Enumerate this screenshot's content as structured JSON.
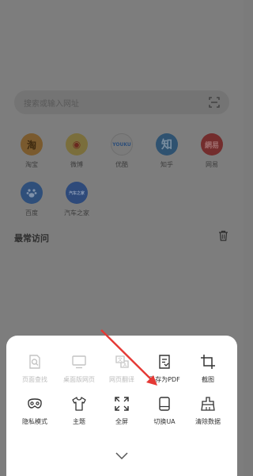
{
  "search": {
    "placeholder": "搜索或输入网址"
  },
  "quick_links": [
    {
      "label": "淘宝",
      "glyph": "淘",
      "color": "#7a5a2e"
    },
    {
      "label": "微博",
      "glyph": "◉",
      "color": "#7a6e3c"
    },
    {
      "label": "优酷",
      "glyph": "YOUKU",
      "color": "#7b7b7b"
    },
    {
      "label": "知乎",
      "glyph": "知",
      "color": "#2f5270"
    },
    {
      "label": "网易",
      "glyph": "網易",
      "color": "#732d2d"
    },
    {
      "label": "百度",
      "glyph": "",
      "color": "#2f4f7a"
    },
    {
      "label": "汽车之家",
      "glyph": "汽车之家",
      "color": "#2e4a7a"
    }
  ],
  "section": {
    "title": "最常访问"
  },
  "menu": {
    "row1": [
      {
        "label": "页面查找",
        "icon": "find-in-page-icon",
        "enabled": false
      },
      {
        "label": "桌面版网页",
        "icon": "desktop-icon",
        "enabled": false
      },
      {
        "label": "网页翻译",
        "icon": "translate-icon",
        "enabled": false
      },
      {
        "label": "另存为PDF",
        "icon": "save-pdf-icon",
        "enabled": true
      },
      {
        "label": "截图",
        "icon": "screenshot-icon",
        "enabled": true
      }
    ],
    "row2": [
      {
        "label": "隐私模式",
        "icon": "incognito-icon",
        "enabled": true
      },
      {
        "label": "主题",
        "icon": "theme-shirt-icon",
        "enabled": true
      },
      {
        "label": "全屏",
        "icon": "fullscreen-icon",
        "enabled": true
      },
      {
        "label": "切换UA",
        "icon": "switch-ua-icon",
        "enabled": true
      },
      {
        "label": "清除数据",
        "icon": "clear-data-icon",
        "enabled": true
      }
    ]
  },
  "colors": {
    "annotation_arrow": "#e53935",
    "overlay": "#7d7d7d"
  }
}
